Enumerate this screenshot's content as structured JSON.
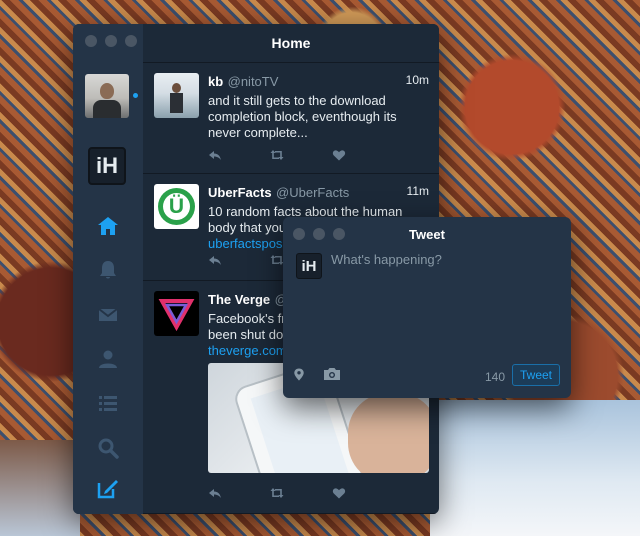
{
  "window": {
    "title": "Home"
  },
  "sidebar": {
    "logo_text": "iH",
    "items": [
      {
        "icon": "home-icon"
      },
      {
        "icon": "bell-icon"
      },
      {
        "icon": "mail-icon"
      },
      {
        "icon": "user-icon"
      },
      {
        "icon": "list-icon"
      },
      {
        "icon": "search-icon"
      },
      {
        "icon": "compose-icon"
      }
    ]
  },
  "tweets": [
    {
      "name": "kb",
      "handle": "@nitoTV",
      "time": "10m",
      "text": "and it still gets to the download\ncompletion block, eventhough its\nnever complete...",
      "link": ""
    },
    {
      "name": "UberFacts",
      "handle": "@UberFacts",
      "time": "11m",
      "text": "10 random facts about the human\nbody that you",
      "link": "uberfactspos"
    },
    {
      "name": "The Verge",
      "handle": "@",
      "time": "",
      "text": "Facebook's fr\nbeen shut do",
      "link": "theverge.com"
    }
  ],
  "compose": {
    "title": "Tweet",
    "logo_text": "iH",
    "placeholder": "What's happening?",
    "char_count": "140",
    "button_label": "Tweet"
  },
  "colors": {
    "accent": "#1da1f2",
    "window_bg": "#1c2938",
    "sidebar_bg": "#243447"
  }
}
